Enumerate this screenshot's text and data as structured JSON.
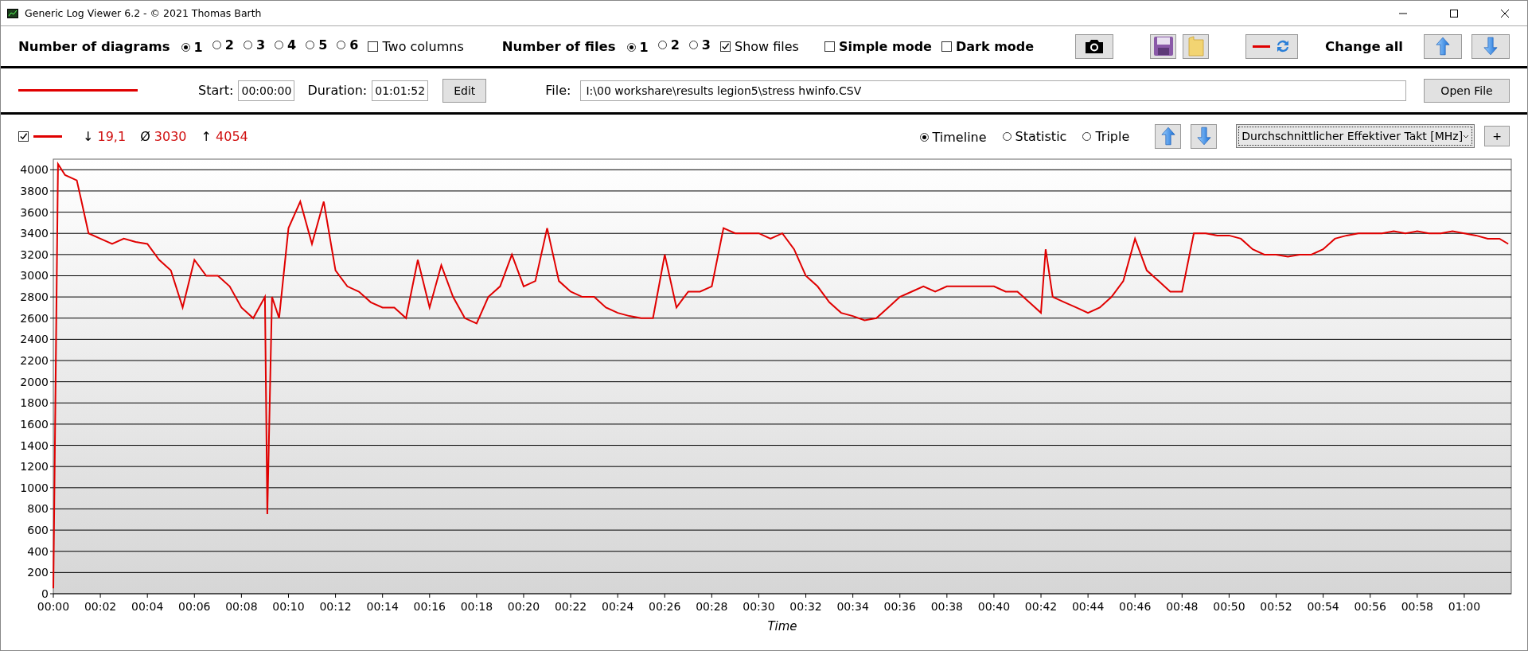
{
  "window": {
    "title": "Generic Log Viewer 6.2 - © 2021 Thomas Barth"
  },
  "toolbar": {
    "diagrams": {
      "label": "Number of diagrams",
      "options": [
        {
          "label": "1",
          "selected": true
        },
        {
          "label": "2",
          "selected": false
        },
        {
          "label": "3",
          "selected": false
        },
        {
          "label": "4",
          "selected": false
        },
        {
          "label": "5",
          "selected": false
        },
        {
          "label": "6",
          "selected": false
        }
      ]
    },
    "two_columns": {
      "label": "Two columns",
      "checked": false
    },
    "files": {
      "label": "Number of files",
      "options": [
        {
          "label": "1",
          "selected": true
        },
        {
          "label": "2",
          "selected": false
        },
        {
          "label": "3",
          "selected": false
        }
      ]
    },
    "show_files": {
      "label": "Show files",
      "checked": true
    },
    "simple_mode": {
      "label": "Simple mode",
      "checked": false
    },
    "dark_mode": {
      "label": "Dark mode",
      "checked": false
    },
    "change_all": "Change all"
  },
  "file_row": {
    "start_label": "Start:",
    "start": "00:00:00",
    "duration_label": "Duration:",
    "duration": "01:01:52",
    "edit_button": "Edit",
    "file_label": "File:",
    "file_path": "I:\\00 workshare\\results legion5\\stress hwinfo.CSV",
    "open_button": "Open File"
  },
  "diagram": {
    "visible": true,
    "stats": [
      {
        "symbol": "↓",
        "value": "19,1"
      },
      {
        "symbol": "Ø",
        "value": "3030"
      },
      {
        "symbol": "↑",
        "value": "4054"
      }
    ],
    "modes": [
      {
        "label": "Timeline",
        "selected": true
      },
      {
        "label": "Statistic",
        "selected": false
      },
      {
        "label": "Triple",
        "selected": false
      }
    ],
    "add_button": "+",
    "chart_data": {
      "type": "line",
      "grid": true,
      "xlabel": "Time",
      "xlim": [
        0,
        62
      ],
      "ylim": [
        0,
        4100
      ],
      "yticks": [
        0,
        200,
        400,
        600,
        800,
        1000,
        1200,
        1400,
        1600,
        1800,
        2000,
        2200,
        2400,
        2600,
        2800,
        3000,
        3200,
        3400,
        3600,
        3800,
        4000
      ],
      "xticks": [
        {
          "value": 0,
          "label": "00:00"
        },
        {
          "value": 2,
          "label": "00:02"
        },
        {
          "value": 4,
          "label": "00:04"
        },
        {
          "value": 6,
          "label": "00:06"
        },
        {
          "value": 8,
          "label": "00:08"
        },
        {
          "value": 10,
          "label": "00:10"
        },
        {
          "value": 12,
          "label": "00:12"
        },
        {
          "value": 14,
          "label": "00:14"
        },
        {
          "value": 16,
          "label": "00:16"
        },
        {
          "value": 18,
          "label": "00:18"
        },
        {
          "value": 20,
          "label": "00:20"
        },
        {
          "value": 22,
          "label": "00:22"
        },
        {
          "value": 24,
          "label": "00:24"
        },
        {
          "value": 26,
          "label": "00:26"
        },
        {
          "value": 28,
          "label": "00:28"
        },
        {
          "value": 30,
          "label": "00:30"
        },
        {
          "value": 32,
          "label": "00:32"
        },
        {
          "value": 34,
          "label": "00:34"
        },
        {
          "value": 36,
          "label": "00:36"
        },
        {
          "value": 38,
          "label": "00:38"
        },
        {
          "value": 40,
          "label": "00:40"
        },
        {
          "value": 42,
          "label": "00:42"
        },
        {
          "value": 44,
          "label": "00:44"
        },
        {
          "value": 46,
          "label": "00:46"
        },
        {
          "value": 48,
          "label": "00:48"
        },
        {
          "value": 50,
          "label": "00:50"
        },
        {
          "value": 52,
          "label": "00:52"
        },
        {
          "value": 54,
          "label": "00:54"
        },
        {
          "value": 56,
          "label": "00:56"
        },
        {
          "value": 58,
          "label": "00:58"
        },
        {
          "value": 60,
          "label": "01:00"
        }
      ],
      "x": [
        0,
        0.2,
        0.5,
        1,
        1.2,
        1.5,
        2,
        2.5,
        3,
        3.5,
        4,
        4.5,
        5,
        5.5,
        6,
        6.5,
        7,
        7.5,
        8,
        8.5,
        9,
        9.1,
        9.3,
        9.6,
        10,
        10.5,
        11,
        11.5,
        12,
        12.5,
        13,
        13.5,
        14,
        14.5,
        15,
        15.5,
        16,
        16.5,
        17,
        17.5,
        18,
        18.5,
        19,
        19.5,
        20,
        20.5,
        21,
        21.5,
        22,
        22.5,
        23,
        23.5,
        24,
        24.5,
        25,
        25.5,
        26,
        26.5,
        27,
        27.5,
        28,
        28.5,
        29,
        29.5,
        30,
        30.5,
        31,
        31.5,
        32,
        32.5,
        33,
        33.5,
        34,
        34.5,
        35,
        35.5,
        36,
        36.5,
        37,
        37.5,
        38,
        38.5,
        39,
        39.5,
        40,
        40.5,
        41,
        41.5,
        42,
        42.2,
        42.5,
        43,
        43.5,
        44,
        44.5,
        45,
        45.5,
        46,
        46.5,
        47,
        47.5,
        48,
        48.5,
        49,
        49.5,
        50,
        50.5,
        51,
        51.5,
        52,
        52.5,
        53,
        53.5,
        54,
        54.5,
        55,
        55.5,
        56,
        56.5,
        57,
        57.5,
        58,
        58.5,
        59,
        59.5,
        60,
        60.5,
        61,
        61.5,
        61.87
      ],
      "series": [
        {
          "name": "Durchschnittlicher Effektiver Takt [MHz]",
          "color": "#e00000",
          "values": [
            50,
            4054,
            3950,
            3900,
            3700,
            3400,
            3350,
            3300,
            3350,
            3320,
            3300,
            3150,
            3050,
            2700,
            3150,
            3000,
            3000,
            2900,
            2700,
            2600,
            2800,
            750,
            2800,
            2600,
            3450,
            3700,
            3300,
            3700,
            3050,
            2900,
            2850,
            2750,
            2700,
            2700,
            2600,
            3150,
            2700,
            3100,
            2800,
            2600,
            2550,
            2800,
            2900,
            3200,
            2900,
            2950,
            3450,
            2950,
            2850,
            2800,
            2800,
            2700,
            2650,
            2620,
            2600,
            2600,
            3200,
            2700,
            2850,
            2850,
            2900,
            3450,
            3400,
            3400,
            3400,
            3350,
            3400,
            3250,
            3000,
            2900,
            2750,
            2650,
            2620,
            2580,
            2600,
            2700,
            2800,
            2850,
            2900,
            2850,
            2900,
            2900,
            2900,
            2900,
            2900,
            2850,
            2850,
            2750,
            2650,
            3250,
            2800,
            2750,
            2700,
            2650,
            2700,
            2800,
            2950,
            3350,
            3050,
            2950,
            2850,
            2850,
            3400,
            3400,
            3380,
            3380,
            3350,
            3250,
            3200,
            3200,
            3180,
            3200,
            3200,
            3250,
            3350,
            3380,
            3400,
            3400,
            3400,
            3420,
            3400,
            3420,
            3400,
            3400,
            3420,
            3400,
            3380,
            3350,
            3350,
            3300
          ]
        }
      ]
    }
  }
}
